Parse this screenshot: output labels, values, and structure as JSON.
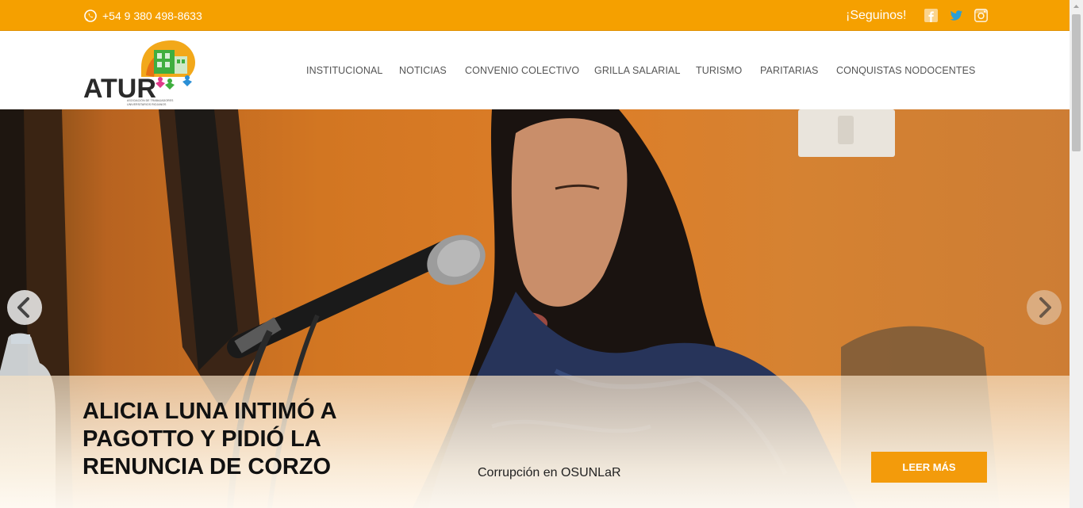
{
  "topbar": {
    "phone": "+54 9 380 498-8633",
    "follow_label": "¡Seguinos!",
    "social_icons": [
      "facebook-icon",
      "twitter-icon",
      "instagram-icon"
    ]
  },
  "logo": {
    "text": "ATUR",
    "tagline": "ASOCIACIÓN DE TRABAJADORES UNIVERSITARIOS RIOJANOS"
  },
  "nav": {
    "items": [
      "INSTITUCIONAL",
      "NOTICIAS",
      "CONVENIO COLECTIVO",
      "GRILLA SALARIAL",
      "TURISMO",
      "PARITARIAS",
      "CONQUISTAS NODOCENTES"
    ]
  },
  "slide": {
    "headline_lines": [
      "ALICIA LUNA INTIMÓ A",
      "PAGOTTO Y PIDIÓ LA",
      "RENUNCIA DE CORZO"
    ],
    "subtitle": "Corrupción en OSUNLaR",
    "button_label": "LEER MÁS"
  },
  "colors": {
    "topbar": "#f5a000",
    "button": "#f39b0b",
    "nav_text": "#555555"
  }
}
